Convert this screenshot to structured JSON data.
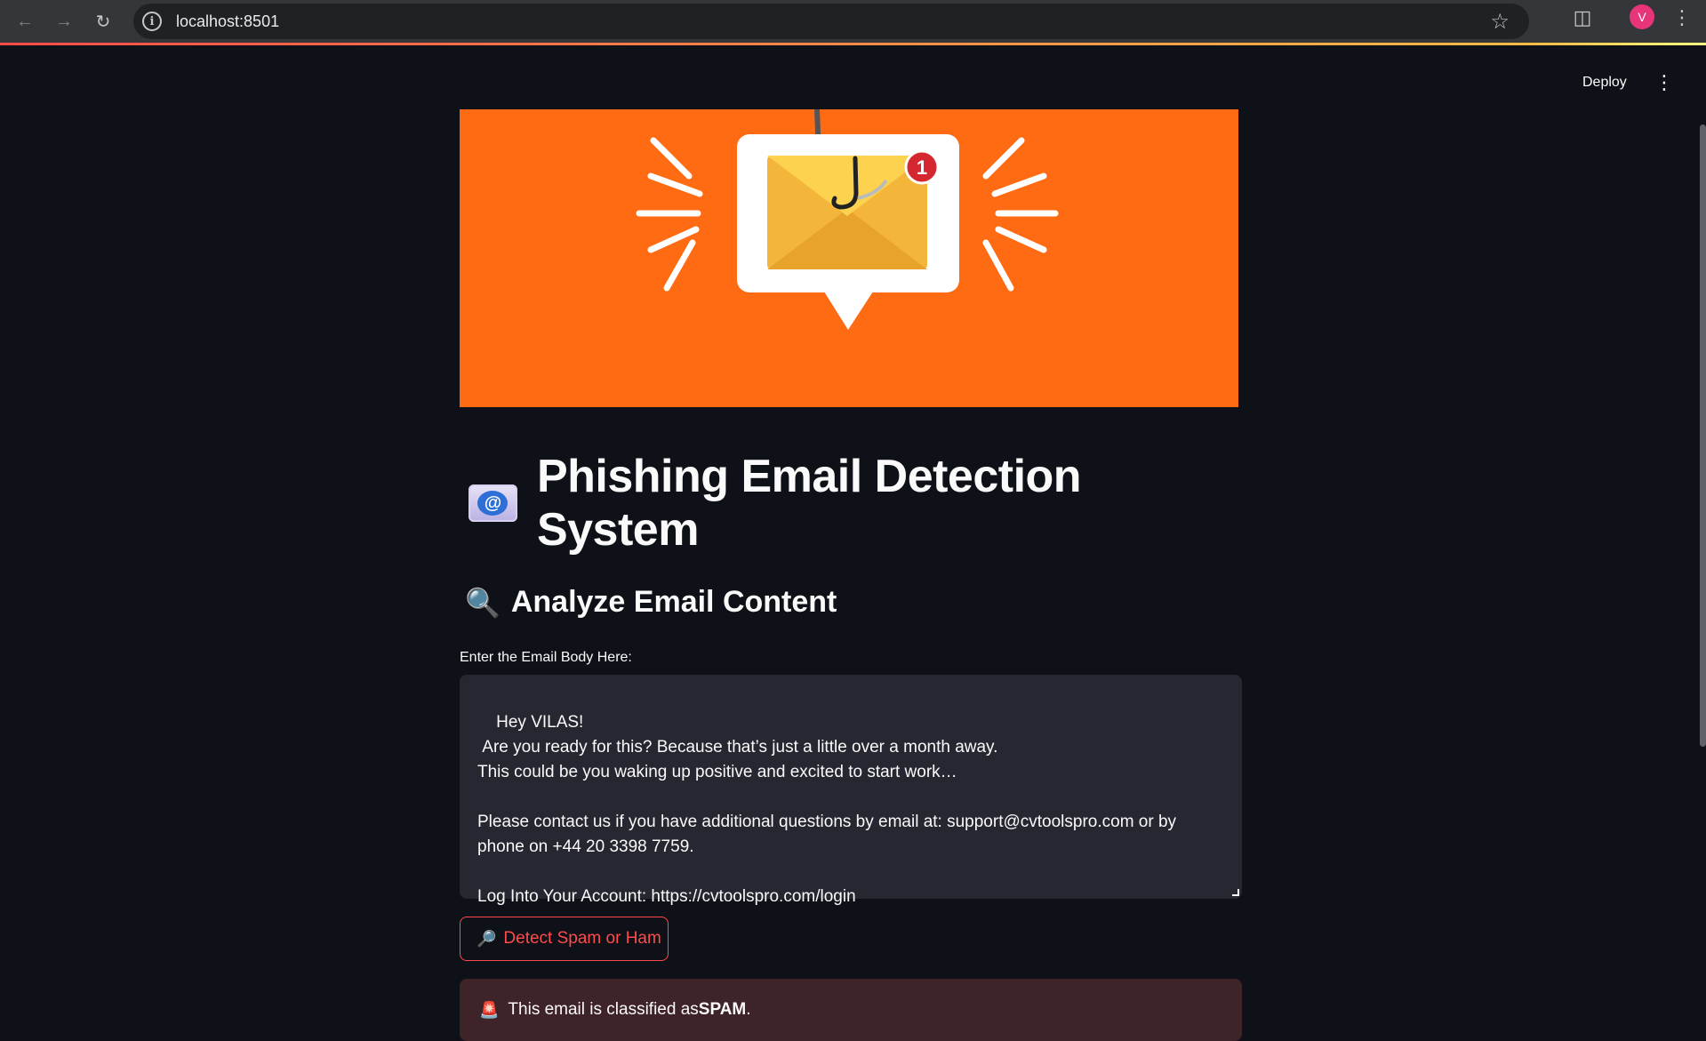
{
  "browser": {
    "url": "localhost:8501",
    "profile_initial": "V",
    "back_icon": "arrow-left-icon",
    "forward_icon": "arrow-right-icon",
    "reload_icon": "reload-icon"
  },
  "header": {
    "deploy_label": "Deploy"
  },
  "banner": {
    "notification_count": "1",
    "background_color": "#ff6b12"
  },
  "main": {
    "title": "Phishing Email Detection System",
    "subtitle": "Analyze Email Content",
    "input_label": "Enter the Email Body Here:",
    "email_body": "Hey VILAS!\n Are you ready for this? Because that’s just a little over a month away.\nThis could be you waking up positive and excited to start work…\n\nPlease contact us if you have additional questions by email at: support@cvtoolspro.com or by\nphone on +44 20 3398 7759.\n\nLog Into Your Account: https://cvtoolspro.com/login",
    "detect_button_label": "Detect Spam or Ham",
    "result_prefix": "This email is classified as ",
    "result_value": "SPAM",
    "result_suffix": "."
  },
  "colors": {
    "accent": "#ff4b4b",
    "background": "#0e1117",
    "input_bg": "#262730",
    "error_bg": "#3e2328"
  }
}
